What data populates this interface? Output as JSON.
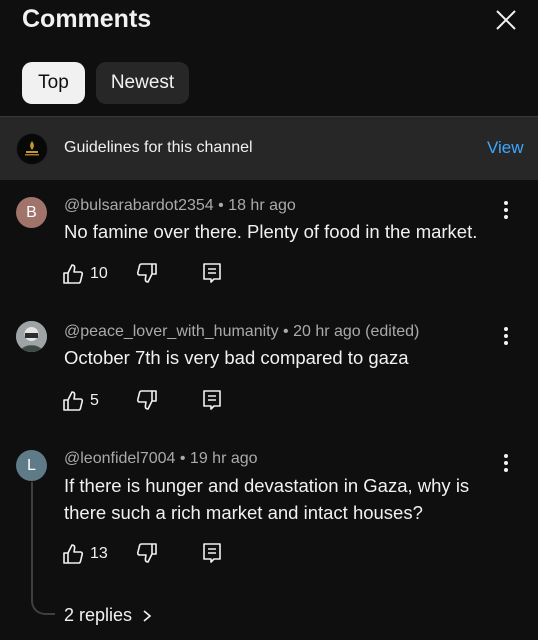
{
  "header": {
    "title": "Comments",
    "close_icon": "close-icon"
  },
  "tabs": [
    {
      "label": "Top",
      "selected": true
    },
    {
      "label": "Newest",
      "selected": false
    }
  ],
  "guidelines": {
    "text": "Guidelines for this channel",
    "action": "View",
    "accent": "#3ea6ff"
  },
  "comments": [
    {
      "avatar_letter": "B",
      "avatar_color": "#a0736b",
      "author": "@bulsarabardot2354",
      "time": "18 hr ago",
      "edited": "",
      "meta": "@bulsarabardot2354 • 18 hr ago",
      "text": "No famine over there. Plenty of food in the market.",
      "likes": "10"
    },
    {
      "avatar_letter": "",
      "avatar_color": "#8a8a8a",
      "author": "@peace_lover_with_humanity",
      "time": "20 hr ago",
      "edited": "(edited)",
      "meta": "@peace_lover_with_humanity • 20 hr ago (edited)",
      "text": "October 7th is very bad compared to gaza",
      "likes": "5"
    },
    {
      "avatar_letter": "L",
      "avatar_color": "#5f7b87",
      "author": "@leonfidel7004",
      "time": "19 hr ago",
      "edited": "",
      "meta": "@leonfidel7004 • 19 hr ago",
      "text": "If there is hunger and devastation in Gaza, why is there such a rich market and intact houses?",
      "likes": "13",
      "replies_label": "2 replies"
    }
  ]
}
